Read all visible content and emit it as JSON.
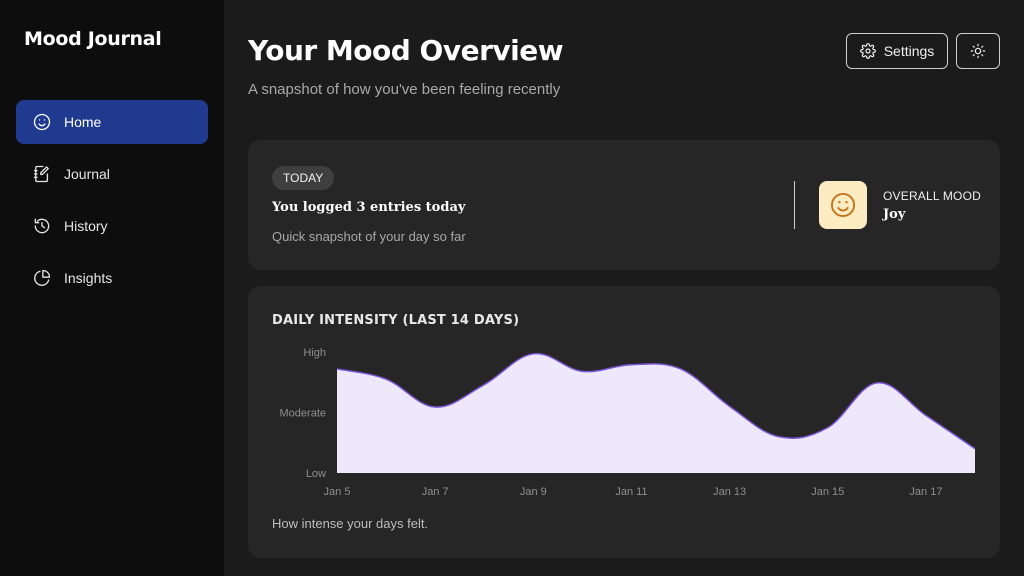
{
  "app": {
    "title": "Mood Journal"
  },
  "sidebar": {
    "items": [
      {
        "label": "Home",
        "icon": "smile-icon",
        "active": true
      },
      {
        "label": "Journal",
        "icon": "journal-edit-icon",
        "active": false
      },
      {
        "label": "History",
        "icon": "history-icon",
        "active": false
      },
      {
        "label": "Insights",
        "icon": "pie-chart-icon",
        "active": false
      }
    ]
  },
  "header": {
    "title": "Your Mood Overview",
    "subtitle": "A snapshot of how you've been feeling recently",
    "settings_label": "Settings",
    "settings_icon": "gear-icon",
    "theme_icon": "sun-icon"
  },
  "today": {
    "badge": "TODAY",
    "headline": "You logged 3 entries today",
    "description": "Quick snapshot of your day so far",
    "overall_label": "OVERALL MOOD",
    "overall_value": "Joy",
    "mood_icon": "smile-icon"
  },
  "chart": {
    "title": "DAILY INTENSITY (LAST 14 DAYS)",
    "caption": "How intense your days felt."
  },
  "chart_data": {
    "type": "area",
    "title": "DAILY INTENSITY (LAST 14 DAYS)",
    "x": [
      "Jan 5",
      "Jan 6",
      "Jan 7",
      "Jan 8",
      "Jan 9",
      "Jan 10",
      "Jan 11",
      "Jan 12",
      "Jan 13",
      "Jan 14",
      "Jan 15",
      "Jan 16",
      "Jan 17",
      "Jan 18"
    ],
    "x_tick_labels": [
      "Jan 5",
      "Jan 7",
      "Jan 9",
      "Jan 11",
      "Jan 13",
      "Jan 15",
      "Jan 17"
    ],
    "values": [
      1.72,
      1.55,
      1.09,
      1.46,
      1.97,
      1.68,
      1.79,
      1.72,
      1.1,
      0.6,
      0.75,
      1.49,
      0.95,
      0.4
    ],
    "y_tick_labels": [
      "Low",
      "Moderate",
      "High"
    ],
    "ylim": [
      0,
      2
    ],
    "grid": false,
    "colors": {
      "line": "#7b55d6",
      "fill": "#ede8fc"
    }
  },
  "colors": {
    "background": "#1b1b1b",
    "sidebar": "#0d0d0d",
    "active_nav": "#1f3a8f",
    "card": "#262626",
    "mood_tile": "#fdebc1",
    "mood_icon": "#c6721c"
  }
}
